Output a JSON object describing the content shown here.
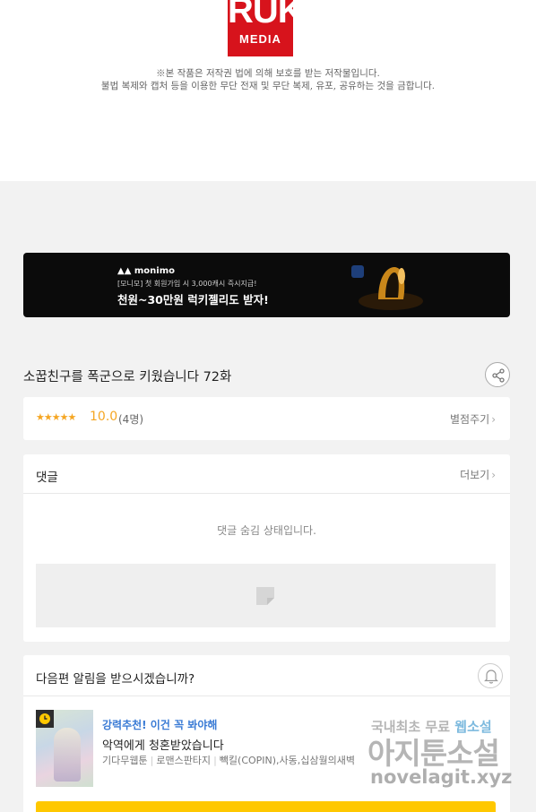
{
  "publisher": {
    "logo_big": "RUK",
    "logo_small": "MEDIA"
  },
  "notice": {
    "line1": "※본 작품은 저작권 법에 의해 보호를 받는 저작물입니다.",
    "line2": "불법 복제와 캡처 등을 이용한 무단 전재 및 무단 복제, 유포, 공유하는 것을 금합니다."
  },
  "banner": {
    "brand": "monimo",
    "sub": "[모니모] 첫 회원가입 시 3,000캐시 즉시지급!",
    "headline": "천원~30만원 럭키젤리도 받자!"
  },
  "episode": {
    "title": "소꿉친구를 폭군으로 키웠습니다 72화"
  },
  "rating": {
    "stars": "★★★★★",
    "score": "10.0",
    "votes": "(4명)",
    "rate_label": "별점주기"
  },
  "comments": {
    "title": "댓글",
    "more_label": "더보기",
    "hidden_message": "댓글 숨김 상태입니다."
  },
  "next_alert": {
    "question": "다음편 알림을 받으시겠습니까?",
    "recommend_label": "강력추천! 이건 꼭 봐야해",
    "work_title": "악역에게 청혼받았습니다",
    "meta": [
      "기다무웹툰",
      "로맨스판타지",
      "빽킬(COPIN),사동,십삼월의새벽"
    ]
  },
  "watermark": {
    "line1": "국내최초 무료",
    "line1_accent": "웹소설",
    "line2": "아지툰소설",
    "line3": "novelagit.xyz"
  },
  "colors": {
    "accent_star": "#f5a623",
    "recommend_blue": "#3a7bd5",
    "cta_yellow": "#ffc800",
    "logo_red": "#d7131c"
  }
}
